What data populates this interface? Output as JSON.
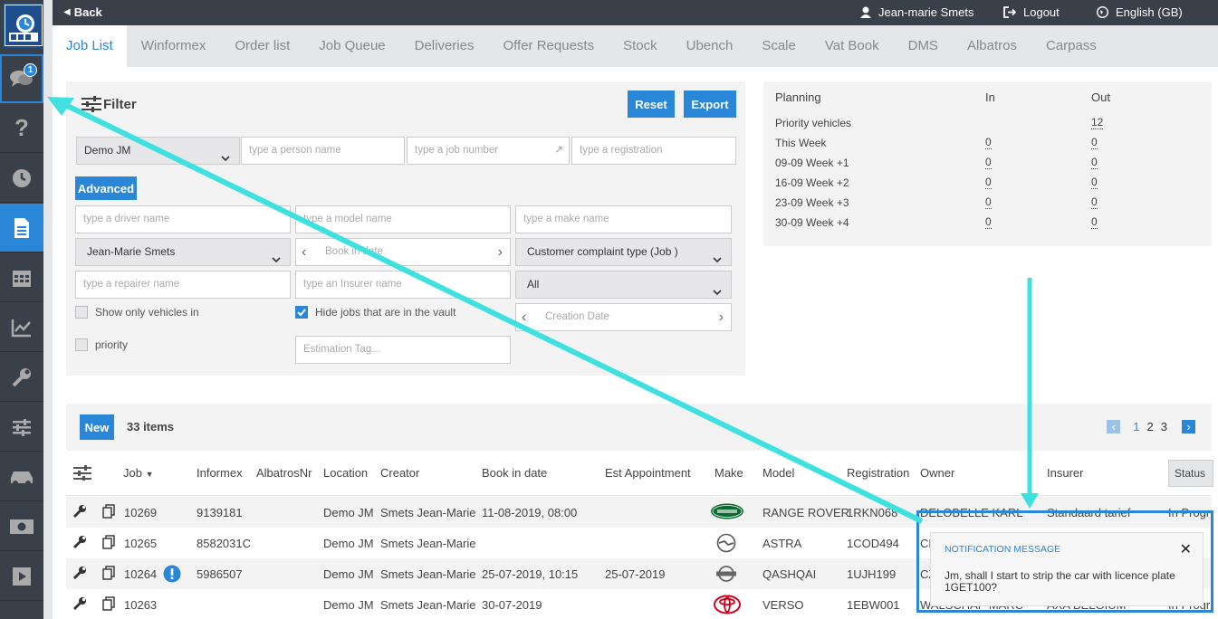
{
  "topbar": {
    "back_label": "Back",
    "user_name": "Jean-marie Smets",
    "logout_label": "Logout",
    "language_label": "English (GB)"
  },
  "sidebar": {
    "chat_badge": "1",
    "items": [
      {
        "icon": "chat-icon"
      },
      {
        "icon": "help-icon"
      },
      {
        "icon": "clock-icon"
      },
      {
        "icon": "document-icon"
      },
      {
        "icon": "calendar-icon"
      },
      {
        "icon": "chart-icon"
      },
      {
        "icon": "wrench-icon"
      },
      {
        "icon": "sliders-icon"
      },
      {
        "icon": "car-icon"
      },
      {
        "icon": "money-icon"
      },
      {
        "icon": "play-icon"
      }
    ],
    "active_index": 3,
    "accent": "#2a86d6",
    "bg": "#394049"
  },
  "tabs": [
    {
      "label": "Job List"
    },
    {
      "label": "Winformex"
    },
    {
      "label": "Order list"
    },
    {
      "label": "Job Queue"
    },
    {
      "label": "Deliveries"
    },
    {
      "label": "Offer Requests"
    },
    {
      "label": "Stock"
    },
    {
      "label": "Ubench"
    },
    {
      "label": "Scale"
    },
    {
      "label": "Vat Book"
    },
    {
      "label": "DMS"
    },
    {
      "label": "Albatros"
    },
    {
      "label": "Carpass"
    }
  ],
  "filter": {
    "title": "Filter",
    "reset_label": "Reset",
    "export_label": "Export",
    "company_select": "Demo JM",
    "person_placeholder": "type a person name",
    "job_number_placeholder": "type a job number",
    "registration_placeholder": "type a registration",
    "advanced_label": "Advanced",
    "driver_placeholder": "type a driver name",
    "model_placeholder": "type a model name",
    "make_placeholder": "type a make name",
    "user_select": "Jean-Marie Smets",
    "book_in_date_placeholder": "Book in date",
    "complaint_select": "Customer complaint type (Job )",
    "repairer_placeholder": "type a repairer name",
    "insurer_placeholder": "type an Insurer name",
    "all_select": "All",
    "show_vehicles_label": "Show only vehicles in",
    "hide_vault_label": "Hide jobs that are in the vault",
    "creation_date_placeholder": "Creation Date",
    "priority_label": "priority",
    "estimation_tag_placeholder": "Estimation Tag..."
  },
  "planning": {
    "header": "Planning",
    "in_header": "In",
    "out_header": "Out",
    "rows": [
      {
        "label": "Priority vehicles",
        "in": "",
        "out": "12"
      },
      {
        "label": "This Week",
        "in": "0",
        "out": "0"
      },
      {
        "label": "09-09 Week +1",
        "in": "0",
        "out": "0"
      },
      {
        "label": "16-09 Week +2",
        "in": "0",
        "out": "0"
      },
      {
        "label": "23-09 Week +3",
        "in": "0",
        "out": "0"
      },
      {
        "label": "30-09 Week +4",
        "in": "0",
        "out": "0"
      }
    ]
  },
  "list": {
    "new_label": "New",
    "item_count": "33 items",
    "pages": [
      "1",
      "2",
      "3"
    ],
    "columns": {
      "job": "Job",
      "informex": "Informex",
      "albatros": "AlbatrosNr",
      "location": "Location",
      "creator": "Creator",
      "book_in_date": "Book in date",
      "est_appointment": "Est Appointment",
      "make": "Make",
      "model": "Model",
      "registration": "Registration",
      "owner": "Owner",
      "insurer": "Insurer",
      "status": "Status"
    },
    "rows": [
      {
        "job": "10269",
        "informex": "9139181",
        "location": "Demo JM",
        "creator": "Smets Jean-Marie",
        "book_in_date": "11-08-2019, 08:00",
        "est_appointment": "",
        "make_logo": "landrover-logo",
        "model": "RANGE ROVER",
        "registration": "1RKN068",
        "owner": "DELOBELLE KARL",
        "insurer": "Standaard tarief",
        "status": "In Progr",
        "alert": false
      },
      {
        "job": "10265",
        "informex": "8582031C",
        "location": "Demo JM",
        "creator": "Smets Jean-Marie",
        "book_in_date": "",
        "est_appointment": "",
        "make_logo": "opel-logo",
        "model": "ASTRA",
        "registration": "1COD494",
        "owner": "CH",
        "insurer": "",
        "status": "",
        "alert": false
      },
      {
        "job": "10264",
        "informex": "5986507",
        "location": "Demo JM",
        "creator": "Smets Jean-Marie",
        "book_in_date": "25-07-2019, 10:15",
        "est_appointment": "25-07-2019",
        "make_logo": "nissan-logo",
        "model": "QASHQAI",
        "registration": "1UJH199",
        "owner": "CZ",
        "insurer": "",
        "status": "",
        "alert": true
      },
      {
        "job": "10263",
        "informex": "",
        "location": "Demo JM",
        "creator": "Smets Jean-Marie",
        "book_in_date": "30-07-2019",
        "est_appointment": "",
        "make_logo": "toyota-logo",
        "model": "VERSO",
        "registration": "1EBW001",
        "owner": "WALSCHAP MARC",
        "insurer": "AXA BELGIUM",
        "status": "In Progr",
        "alert": false
      }
    ]
  },
  "notification": {
    "title": "NOTIFICATION MESSAGE",
    "message": "Jm, shall I start to strip the car with licence plate 1GET100?"
  },
  "annotation_color": "#3ee0e0"
}
